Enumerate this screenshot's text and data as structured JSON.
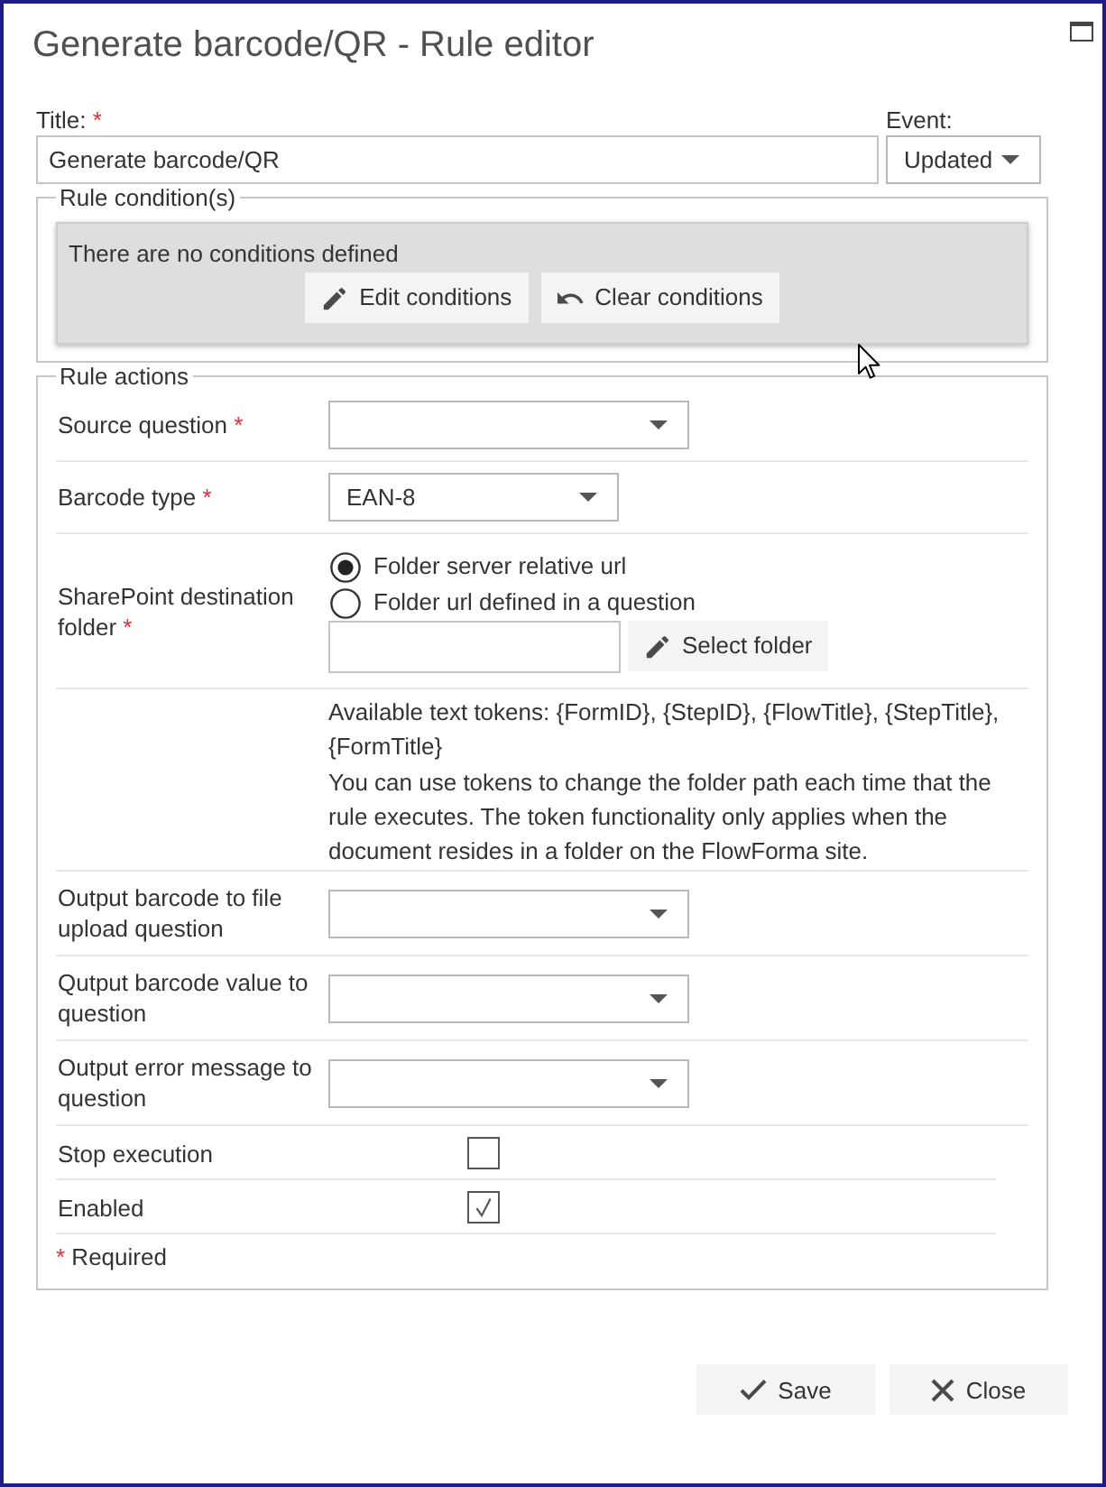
{
  "window": {
    "title": "Generate barcode/QR - Rule editor"
  },
  "title_field": {
    "label": "Title:",
    "required_mark": "*",
    "value": "Generate barcode/QR"
  },
  "event_field": {
    "label": "Event:",
    "value": "Updated"
  },
  "conditions": {
    "legend": "Rule condition(s)",
    "message": "There are no conditions defined",
    "buttons": [
      {
        "kind": "edit",
        "label": "Edit conditions"
      },
      {
        "kind": "clear",
        "label": "Clear conditions"
      }
    ]
  },
  "actions": {
    "legend": "Rule actions",
    "rows": [
      {
        "kind": "select",
        "label": "Source question",
        "required_mark": "*"
      },
      {
        "kind": "select",
        "label": "Barcode type",
        "required_mark": "*",
        "value": "EAN-8"
      },
      {
        "kind": "folder",
        "label": "SharePoint destination folder",
        "required_mark": "*",
        "options": [
          {
            "label": "Folder server relative url",
            "selected": true
          },
          {
            "label": "Folder url defined in a question",
            "selected": false
          }
        ],
        "button": "Select folder"
      },
      {
        "kind": "note",
        "paragraphs": [
          "Available text tokens: {FormID}, {StepID}, {FlowTitle}, {StepTitle}, {FormTitle}",
          "You can use tokens to change the folder path each time that the rule executes. The token functionality only applies when the document resides in a folder on the FlowForma site."
        ]
      },
      {
        "kind": "select",
        "label": "Output barcode to file upload question"
      },
      {
        "kind": "select",
        "label": "Qutput barcode value to question"
      },
      {
        "kind": "select",
        "label": "Output error message to question"
      },
      {
        "kind": "checkbox",
        "label": "Stop execution",
        "checked": false
      },
      {
        "kind": "checkbox",
        "label": "Enabled",
        "checked": true
      }
    ],
    "required_note": {
      "mark": "*",
      "text": "Required"
    }
  },
  "buttons": [
    {
      "kind": "save",
      "label": "Save"
    },
    {
      "kind": "close",
      "label": "Close"
    }
  ]
}
